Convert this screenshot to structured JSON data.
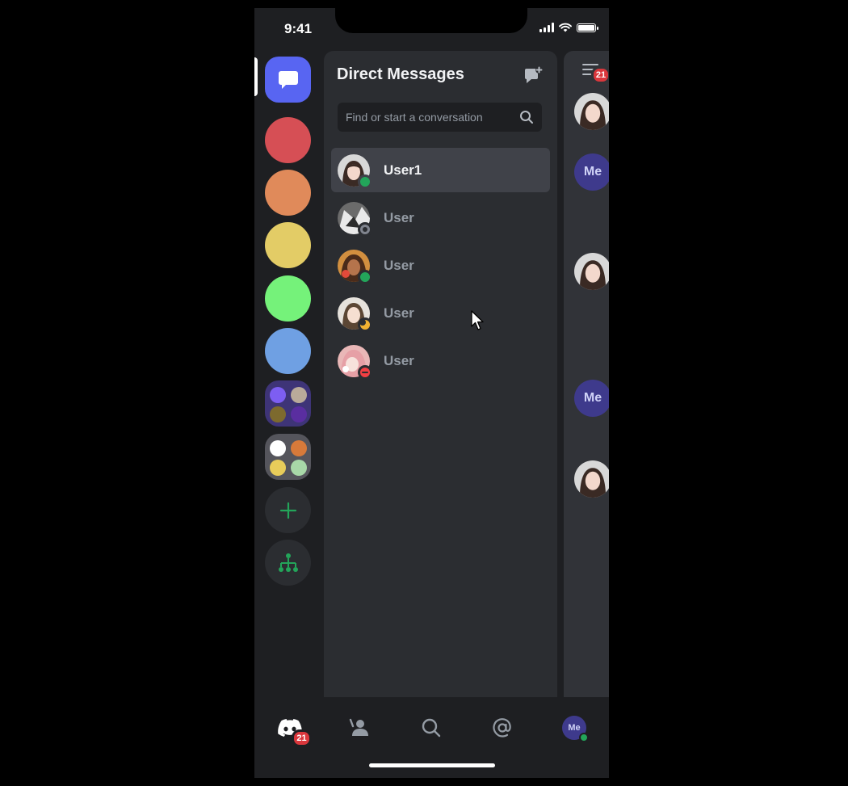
{
  "status_bar": {
    "time": "9:41"
  },
  "direct_messages": {
    "title": "Direct Messages",
    "search_placeholder": "Find or start a conversation",
    "conversations": [
      {
        "name": "User1",
        "status": "online",
        "selected": true
      },
      {
        "name": "User",
        "status": "offline",
        "selected": false
      },
      {
        "name": "User",
        "status": "online",
        "selected": false
      },
      {
        "name": "User",
        "status": "idle",
        "selected": false
      },
      {
        "name": "User",
        "status": "dnd",
        "selected": false
      }
    ]
  },
  "server_rail": {
    "servers": [
      {
        "color": "#d64f55"
      },
      {
        "color": "#e08a5a"
      },
      {
        "color": "#e3cc66"
      },
      {
        "color": "#75f27a"
      },
      {
        "color": "#6fa0e3"
      }
    ],
    "folders": [
      {
        "background": "#3e3477",
        "dots": [
          "#7d5ef2",
          "#b9aa9a",
          "#7d6a2e",
          "#5a2ea0"
        ]
      },
      {
        "background": "#55555c",
        "dots": [
          "#ffffff",
          "#d77a3a",
          "#e8cc5a",
          "#a8d8a8"
        ]
      }
    ]
  },
  "peek_panel": {
    "badge": "21",
    "me_label": "Me"
  },
  "bottom_nav": {
    "home_badge": "21",
    "profile_label": "Me"
  },
  "colors": {
    "accent": "#5865f2",
    "online": "#23a55a",
    "idle": "#f0b232",
    "dnd": "#f23f43",
    "offline": "#80848e",
    "badge": "#da373c",
    "add_green": "#23a55a"
  }
}
